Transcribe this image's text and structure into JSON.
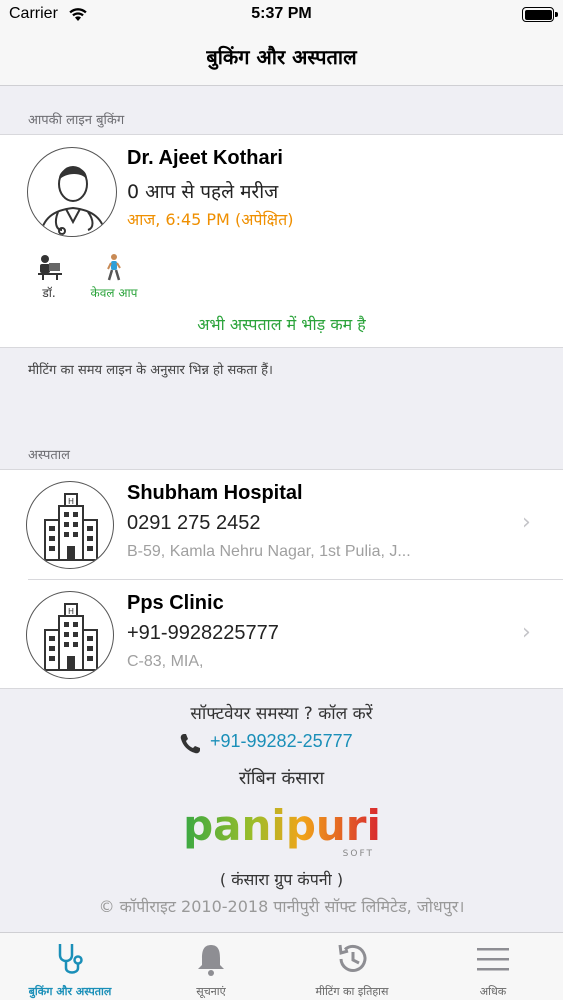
{
  "status_bar": {
    "carrier": "Carrier",
    "time": "5:37 PM"
  },
  "nav": {
    "title": "बुकिंग और अस्पताल"
  },
  "booking": {
    "section_header": "आपकी लाइन बुकिंग",
    "doctor_name": "Dr. Ajeet Kothari",
    "patients_ahead": "0 आप से पहले मरीज",
    "expected_time": "आज, 6:45 PM (अपेक्षित)",
    "doctor_label": "डॉ.",
    "only_you_label": "केवल आप",
    "crowd_status": "अभी अस्पताल में भीड़ कम है",
    "note": "मीटिंग का समय लाइन के अनुसार भिन्न हो सकता हैं।"
  },
  "hospitals": {
    "section_header": "अस्पताल",
    "items": [
      {
        "name": "Shubham Hospital",
        "phone": "0291 275 2452",
        "address": "B-59, Kamla Nehru Nagar, 1st Pulia, J..."
      },
      {
        "name": "Pps Clinic",
        "phone": "+91-9928225777",
        "address": "C-83, MIA,"
      }
    ]
  },
  "footer": {
    "help_text": "सॉफ्टवेयर समस्या ? कॉल करें",
    "help_phone": "+91-99282-25777",
    "owner": "रॉबिन कंसारा",
    "logo_text": "panipuri",
    "logo_sub": "SOFT",
    "group": "( कंसारा ग्रुप कंपनी )",
    "copyright": "© कॉपीराइट 2010-2018 पानीपुरी सॉफ्ट लिमिटेड, जोधपुर।"
  },
  "tabs": [
    {
      "label": "बुकिंग और अस्पताल",
      "icon": "stethoscope-icon",
      "active": true
    },
    {
      "label": "सूचनाएं",
      "icon": "bell-icon",
      "active": false
    },
    {
      "label": "मीटिंग का इतिहास",
      "icon": "history-icon",
      "active": false
    },
    {
      "label": "अधिक",
      "icon": "menu-icon",
      "active": false
    }
  ],
  "colors": {
    "accent": "#1a8fb8",
    "eta": "#ef8f00",
    "crowd": "#2aa33a"
  }
}
